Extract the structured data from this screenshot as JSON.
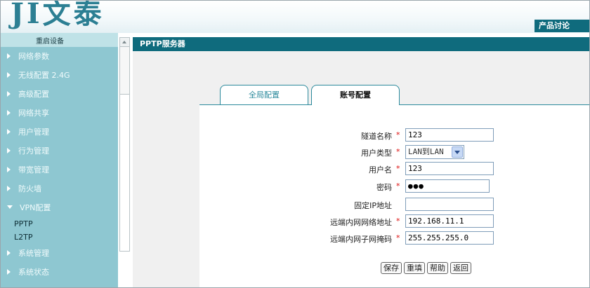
{
  "header": {
    "logo_text": "JI文泰",
    "forum_link": "产品讨论"
  },
  "sidebar": {
    "top_item": "重启设备",
    "items": [
      {
        "label": "网络参数"
      },
      {
        "label": "无线配置 2.4G"
      },
      {
        "label": "高级配置"
      },
      {
        "label": "网络共享"
      },
      {
        "label": "用户管理"
      },
      {
        "label": "行为管理"
      },
      {
        "label": "带宽管理"
      },
      {
        "label": "防火墙"
      },
      {
        "label": "VPN配置",
        "expanded": true,
        "children": [
          "PPTP",
          "L2TP"
        ]
      },
      {
        "label": "系统管理"
      },
      {
        "label": "系统状态"
      }
    ]
  },
  "page": {
    "title": "PPTP服务器",
    "tabs": [
      {
        "label": "全局配置",
        "active": false
      },
      {
        "label": "账号配置",
        "active": true
      }
    ]
  },
  "form": {
    "required_mark": "*",
    "tunnel_name": {
      "label": "隧道名称",
      "value": "123",
      "required": true
    },
    "user_type": {
      "label": "用户类型",
      "value": "LAN到LAN",
      "required": true
    },
    "username": {
      "label": "用户名",
      "value": "123",
      "required": true
    },
    "password": {
      "label": "密码",
      "value": "●●●",
      "required": true
    },
    "fixed_ip": {
      "label": "固定IP地址",
      "value": "",
      "required": false
    },
    "remote_net": {
      "label": "远端内网网络地址",
      "value": "192.168.11.1",
      "required": true
    },
    "remote_mask": {
      "label": "远端内网子网掩码",
      "value": "255.255.255.0",
      "required": true
    }
  },
  "buttons": {
    "save": "保存",
    "reset": "重填",
    "help": "帮助",
    "back": "返回"
  },
  "colors": {
    "accent": "#0f6b7d",
    "sidebar": "#8ec7d1",
    "required": "#dd1111"
  }
}
